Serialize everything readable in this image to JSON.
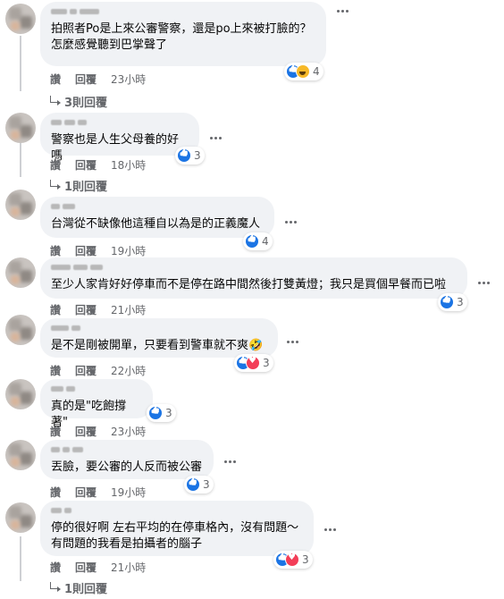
{
  "labels": {
    "like": "讚",
    "reply": "回覆"
  },
  "comments": [
    {
      "text": "拍照者Po是上來公審警察，還是po上來被打臉的？\n怎麼感覺聽到巴掌聲了",
      "time": "23小時",
      "reactions": [
        "like",
        "haha"
      ],
      "count": "4",
      "replies": "3則回覆"
    },
    {
      "text": "警察也是人生父母養的好嗎",
      "time": "18小時",
      "reactions": [
        "like"
      ],
      "count": "3",
      "replies": "1則回覆"
    },
    {
      "text": "台灣從不缺像他這種自以為是的正義魔人",
      "time": "19小時",
      "reactions": [
        "like"
      ],
      "count": "4"
    },
    {
      "text": "至少人家肯好好停車而不是停在路中間然後打雙黃燈；我只是買個早餐而已啦",
      "time": "21小時",
      "reactions": [
        "like"
      ],
      "count": "3"
    },
    {
      "text": "是不是剛被開單，只要看到警車就不爽🤣",
      "time": "22小時",
      "reactions": [
        "like",
        "love"
      ],
      "count": "3"
    },
    {
      "text": "真的是\"吃飽撐著\"",
      "time": "23小時",
      "reactions": [
        "like"
      ],
      "count": "3"
    },
    {
      "text": "丟臉，要公審的人反而被公審",
      "time": "19小時",
      "reactions": [
        "like"
      ],
      "count": "3"
    },
    {
      "text": "停的很好啊 左右平均的在停車格內，沒有問題～\n有問題的我看是拍攝者的腦子",
      "time": "21小時",
      "reactions": [
        "like",
        "love"
      ],
      "count": "3",
      "replies": "1則回覆"
    }
  ]
}
